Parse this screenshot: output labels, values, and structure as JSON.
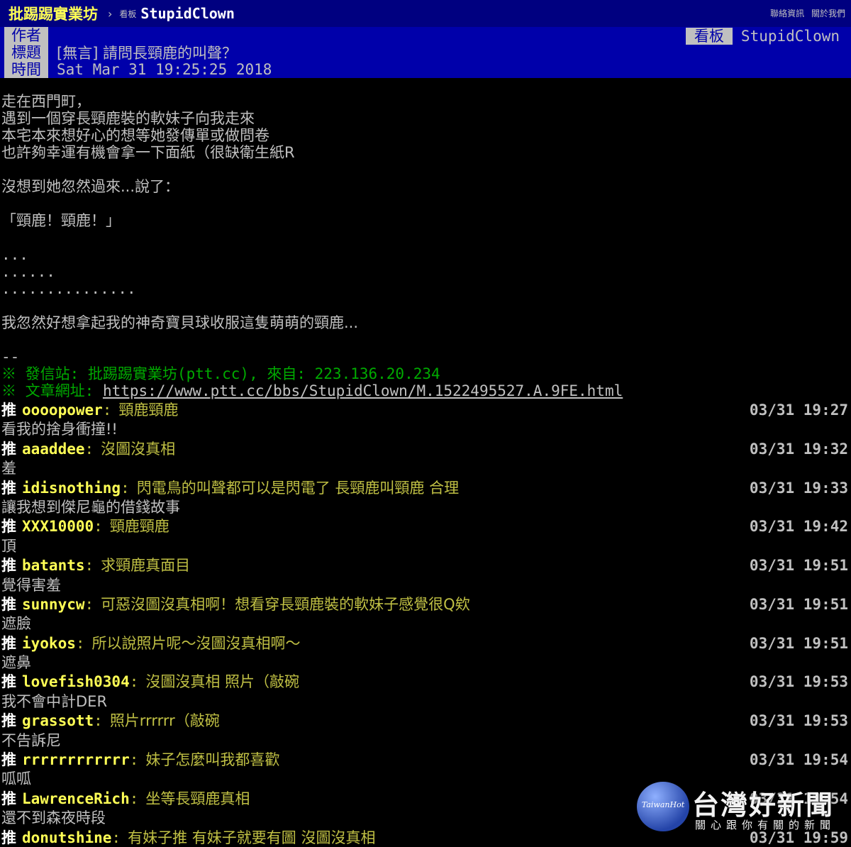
{
  "topbar": {
    "site_name": "批踢踢實業坊",
    "separator": "›",
    "board_label": "看板",
    "board_name": "StupidClown",
    "links": [
      "聯絡資訊",
      "關於我們"
    ]
  },
  "meta": {
    "author_tag": "作者",
    "title_tag": "標題",
    "time_tag": "時間",
    "board_tag": "看板",
    "author": "",
    "title": "[無言] 請問長頸鹿的叫聲？",
    "time": "Sat Mar 31 19:25:25 2018",
    "board": "StupidClown"
  },
  "content": {
    "lines": [
      "走在西門町，",
      "遇到一個穿長頸鹿裝的軟妹子向我走來",
      "本宅本來想好心的想等她發傳單或做問卷",
      "也許夠幸運有機會拿一下面紙（很缺衛生紙R",
      "",
      "沒想到她忽然過來...說了：",
      "",
      "「頸鹿！頸鹿！」",
      "",
      "...",
      "......",
      "...............",
      "",
      "我忽然好想拿起我的神奇寶貝球收服這隻萌萌的頸鹿...",
      "",
      "--"
    ],
    "signature_site": "※ 發信站: 批踢踢實業坊(ptt.cc), 來自: 223.136.20.234",
    "signature_url_prefix": "※ 文章網址: ",
    "signature_url": "https://www.ptt.cc/bbs/StupidClown/M.1522495527.A.9FE.html"
  },
  "pushes": [
    {
      "tag": "推",
      "user": "oooopower",
      "msg": "頸鹿頸鹿",
      "time": "03/31 19:27",
      "reply": "看我的捨身衝撞!!"
    },
    {
      "tag": "推",
      "user": "aaaddee",
      "msg": "沒圖沒真相",
      "time": "03/31 19:32",
      "reply": "羞"
    },
    {
      "tag": "推",
      "user": "idisnothing",
      "msg": "閃電鳥的叫聲都可以是閃電了 長頸鹿叫頸鹿 合理",
      "time": "03/31 19:33",
      "reply": "讓我想到傑尼龜的借錢故事"
    },
    {
      "tag": "推",
      "user": "XXX10000",
      "msg": "頸鹿頸鹿",
      "time": "03/31 19:42",
      "reply": "頂"
    },
    {
      "tag": "推",
      "user": "batants",
      "msg": "求頸鹿真面目",
      "time": "03/31 19:51",
      "reply": "覺得害羞"
    },
    {
      "tag": "推",
      "user": "sunnycw",
      "msg": "可惡沒圖沒真相啊！想看穿長頸鹿裝的軟妹子感覺很Q欸",
      "time": "03/31 19:51",
      "reply": "遮臉"
    },
    {
      "tag": "推",
      "user": "iyokos",
      "msg": "所以說照片呢～沒圖沒真相啊～",
      "time": "03/31 19:51",
      "reply": "遮鼻"
    },
    {
      "tag": "推",
      "user": "lovefish0304",
      "msg": "沒圖沒真相 照片（敲碗",
      "time": "03/31 19:53",
      "reply": "我不會中計DER"
    },
    {
      "tag": "推",
      "user": "grassott",
      "msg": "照片rrrrrr（敲碗",
      "time": "03/31 19:53",
      "reply": "不告訴尼"
    },
    {
      "tag": "推",
      "user": "rrrrrrrrrrrr",
      "msg": "妹子怎麼叫我都喜歡",
      "time": "03/31 19:54",
      "reply": "呱呱"
    },
    {
      "tag": "推",
      "user": "LawrenceRich",
      "msg": "坐等長頸鹿真相",
      "time": "03/31 19:54",
      "reply": "還不到森夜時段"
    },
    {
      "tag": "推",
      "user": "donutshine",
      "msg": "有妹子推 有妹子就要有圖 沒圖沒真相",
      "time": "03/31 19:59",
      "reply": ""
    }
  ],
  "watermark": {
    "circle_text": "TaiwanHot",
    "title": "台灣好新聞",
    "subtitle": "關心跟你有關的新聞"
  }
}
